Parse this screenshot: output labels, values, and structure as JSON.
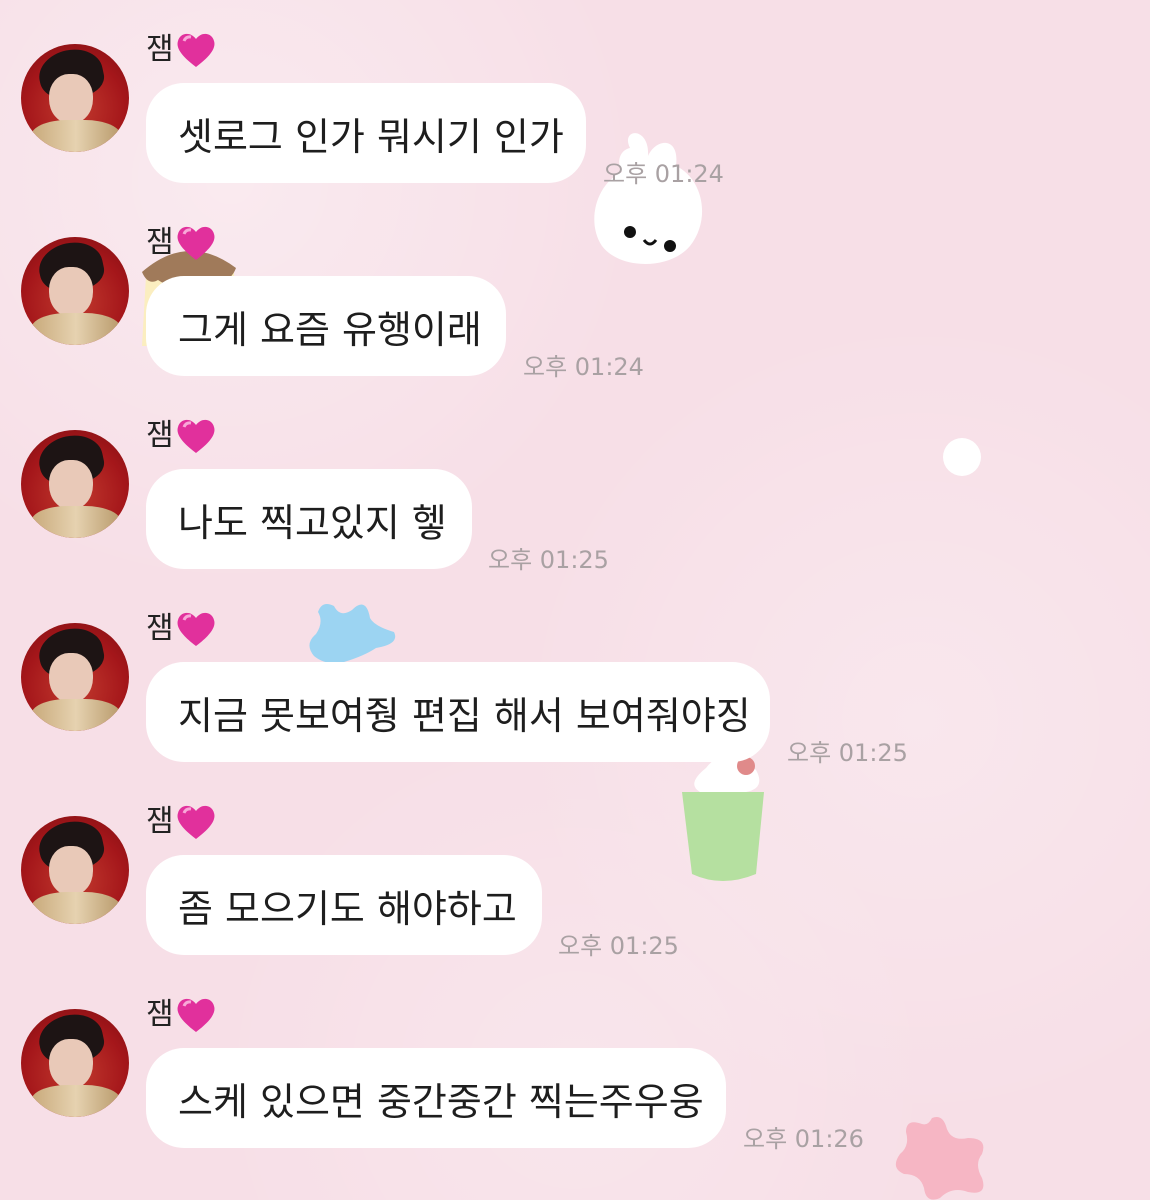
{
  "chat": {
    "messages": [
      {
        "sender": "잼",
        "text": "셋로그 인가 뭐시기 인가",
        "time": "오후 01:24"
      },
      {
        "sender": "잼",
        "text": "그게 요즘 유행이래",
        "time": "오후 01:24"
      },
      {
        "sender": "잼",
        "text": "나도 찍고있지 헿",
        "time": "오후 01:25"
      },
      {
        "sender": "잼",
        "text": "지금 못보여줭 편집 해서 보여줘야징",
        "time": "오후 01:25"
      },
      {
        "sender": "잼",
        "text": "좀 모으기도 해야하고",
        "time": "오후 01:25"
      },
      {
        "sender": "잼",
        "text": "스케 있으면 중간중간 찍는주우웅",
        "time": "오후 01:26"
      }
    ]
  },
  "icons": {
    "sender_badge": "pink-heart-icon",
    "avatar": "profile-photo"
  },
  "colors": {
    "background": "#f7dfe7",
    "bubble": "#ffffff",
    "timestamp": "#a9a1a3",
    "heart": "#e1309c"
  }
}
